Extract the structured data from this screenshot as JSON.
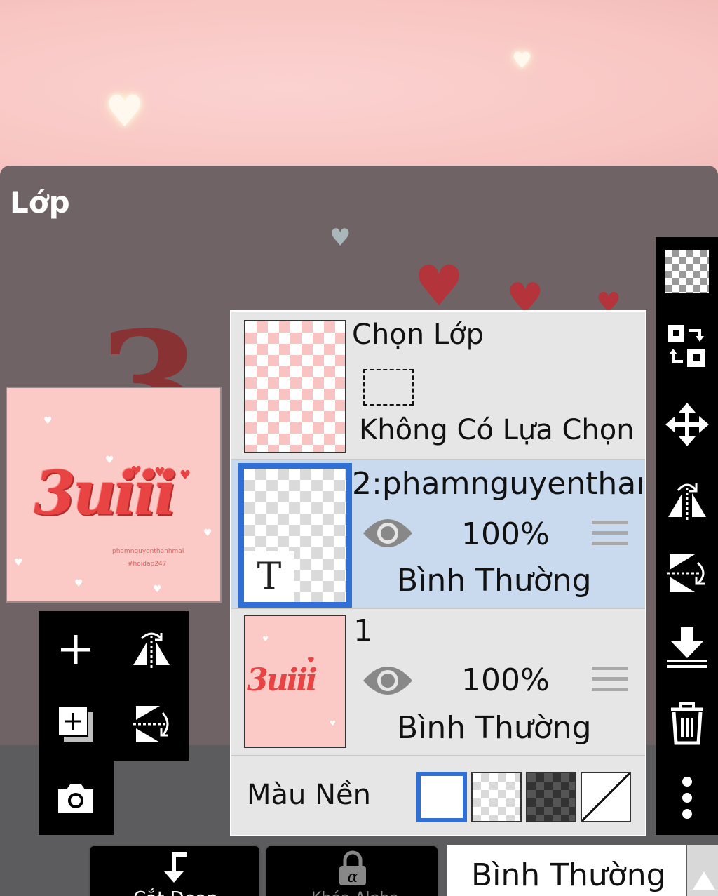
{
  "panel": {
    "title": "Lớp"
  },
  "preview": {
    "art_text": "3uiii",
    "credit_line1": "phamnguyenthanhmai",
    "credit_line2": "#hoidap247"
  },
  "layers_list": {
    "selection_row": {
      "title": "Chọn Lớp",
      "status": "Không Có Lựa Chọn"
    },
    "layers": [
      {
        "name": "2:phamnguyenthar",
        "opacity": "100%",
        "blend": "Bình Thường",
        "visible": true,
        "selected": true,
        "type_badge": "T"
      },
      {
        "name": "1",
        "opacity": "100%",
        "blend": "Bình Thường",
        "visible": true,
        "selected": false,
        "thumb_text": "3uiii"
      }
    ],
    "background_row": {
      "label": "Màu Nền"
    }
  },
  "left_tools": [
    {
      "icon": "plus-icon"
    },
    {
      "icon": "flip-horizontal-icon"
    },
    {
      "icon": "add-layer-icon"
    },
    {
      "icon": "flip-vertical-icon"
    },
    {
      "icon": "camera-icon"
    }
  ],
  "right_toolbar": [
    {
      "icon": "transparency-checker-icon"
    },
    {
      "icon": "swap-layer-icon"
    },
    {
      "icon": "move-icon"
    },
    {
      "icon": "flip-horizontal-icon"
    },
    {
      "icon": "flip-vertical-icon"
    },
    {
      "icon": "merge-down-icon"
    },
    {
      "icon": "trash-icon"
    },
    {
      "icon": "more-icon"
    }
  ],
  "bottom": {
    "clip_label": "Cắt Đoạn",
    "alpha_lock_label": "Khóa Alpha",
    "blend_mode": "Bình Thường"
  },
  "colors": {
    "accent_blue": "#2f6fd6",
    "selected_row": "#c9d9ee",
    "canvas_pink": "#f8c6c3",
    "art_red": "#e94444"
  }
}
